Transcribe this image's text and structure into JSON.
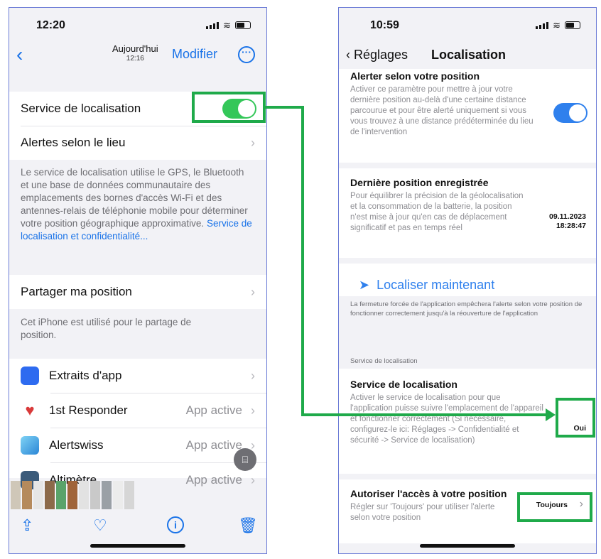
{
  "left": {
    "status_time": "12:20",
    "nav": {
      "date_line1": "Aujourd'hui",
      "date_line2": "12:16",
      "modifier": "Modifier"
    },
    "rows": {
      "location_service": "Service de localisation",
      "alerts_by_place": "Alertes selon le lieu",
      "share_position": "Partager ma position"
    },
    "location_footnote": "Le service de localisation utilise le GPS, le Bluetooth et une base de données communautaire des emplacements des bornes d'accès Wi-Fi et des antennes-relais de téléphonie mobile pour déterminer votre position géographique approximative.",
    "location_footnote_link": "Service de localisation et confidentialité...",
    "share_footnote": "Cet iPhone est utilisé pour le partage de position.",
    "apps": [
      {
        "name": "Extraits d'app",
        "value": "",
        "color": "#2e6bf0"
      },
      {
        "name": "1st Responder",
        "value": "App active",
        "color": "#d93a3a"
      },
      {
        "name": "Alertswiss",
        "value": "App active",
        "color": "#3aa0e0"
      },
      {
        "name": "Altimètre",
        "value": "App active",
        "color": "#3b5b7a"
      }
    ]
  },
  "right": {
    "status_time": "10:59",
    "nav": {
      "back": "Réglages",
      "title": "Localisation"
    },
    "alert_position": {
      "title": "Alerter selon votre position",
      "desc": "Activer ce paramètre pour mettre à jour votre dernière position au-delà d'une certaine distance parcourue et pour être alerté uniquement si vous vous trouvez à une distance prédéterminée du lieu de l'intervention"
    },
    "last_position": {
      "title": "Dernière position enregistrée",
      "desc": "Pour équilibrer la précision de la géolocalisation et la consommation de la batterie, la position n'est mise à jour qu'en cas de déplacement significatif et pas en temps réel",
      "date": "09.11.2023",
      "time": "18:28:47"
    },
    "locate_now": "Localiser maintenant",
    "force_close_note": "La fermeture forcée de l'application empêchera l'alerte selon votre position de fonctionner correctement jusqu'à la réouverture de l'application",
    "section_header": "Service de localisation",
    "location_service": {
      "title": "Service de localisation",
      "desc": "Activer le service de localisation pour que l'application puisse suivre l'emplacement de l'appareil et fonctionner correctement (Si nécessaire, configurez-le ici: Réglages -> Confidentialité et sécurité -> Service de localisation)",
      "value": "Oui"
    },
    "authorize": {
      "title": "Autoriser l'accès à votre position",
      "desc": "Régler sur 'Toujours' pour utiliser l'alerte selon votre position",
      "value": "Toujours"
    }
  },
  "colors": {
    "ios_blue": "#1a73e8",
    "toggle_green": "#34c759",
    "highlight_green": "#1faa4a"
  }
}
